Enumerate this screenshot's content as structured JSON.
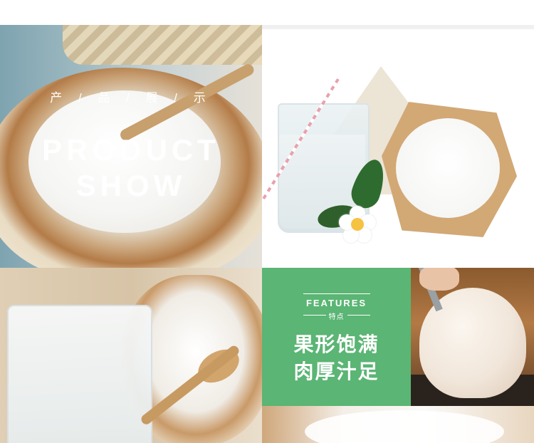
{
  "product_show": {
    "title_cn": "产 / 品 / 展 / 示",
    "title_en_line1": "PRODUCT",
    "title_en_line2": "SHOW"
  },
  "features": {
    "label_en": "FEATURES",
    "label_cn": "特点",
    "line1": "果形饱满",
    "line2": "肉厚汁足"
  },
  "colors": {
    "features_green": "#5bb574",
    "text_white": "#ffffff"
  }
}
